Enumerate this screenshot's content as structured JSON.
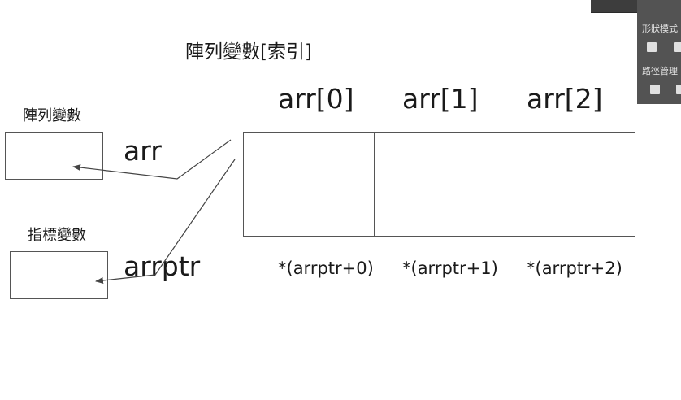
{
  "title": "陣列變數[索引]",
  "array_var": {
    "heading": "陣列變數",
    "name": "arr"
  },
  "pointer_var": {
    "heading": "指標變數",
    "name": "arrptr"
  },
  "cells": [
    {
      "index_label": "arr[0]",
      "deref_label": "*(arrptr+0)"
    },
    {
      "index_label": "arr[1]",
      "deref_label": "*(arrptr+1)"
    },
    {
      "index_label": "arr[2]",
      "deref_label": "*(arrptr+2)"
    }
  ],
  "side_panel": {
    "section1": "形狀模式",
    "section2": "路徑管理",
    "icons": [
      "unite-shape-icon",
      "minus-front-icon",
      "divide-path-icon",
      "trim-path-icon"
    ]
  }
}
